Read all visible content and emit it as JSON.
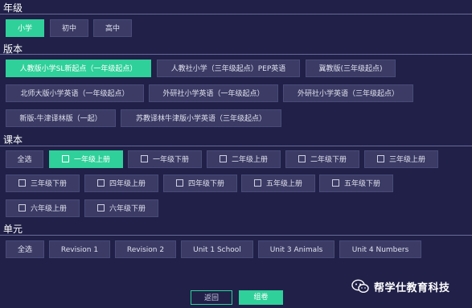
{
  "grade": {
    "title": "年级",
    "options": [
      "小学",
      "初中",
      "高中"
    ],
    "selected": "小学"
  },
  "edition": {
    "title": "版本",
    "options": [
      "人教版小学SL新起点（一年级起点）",
      "人教社小学（三年级起点）PEP英语",
      "冀教版(三年级起点)",
      "北师大版小学英语（一年级起点）",
      "外研社小学英语（一年级起点）",
      "外研社小学英语（三年级起点）",
      "新版-牛津译林版（一起）",
      "苏教译林牛津版小学英语（三年级起点）"
    ],
    "selected": "人教版小学SL新起点（一年级起点）"
  },
  "textbook": {
    "title": "课本",
    "select_all": "全选",
    "options": [
      "一年级上册",
      "一年级下册",
      "二年级上册",
      "二年级下册",
      "三年级上册",
      "三年级下册",
      "四年级上册",
      "四年级下册",
      "五年级上册",
      "五年级下册",
      "六年级上册",
      "六年级下册"
    ],
    "checked": [
      "一年级上册"
    ]
  },
  "unit": {
    "title": "单元",
    "select_all": "全选",
    "options": [
      "Revision 1",
      "Revision 2",
      "Unit 1 School",
      "Unit 3 Animals",
      "Unit 4 Numbers"
    ]
  },
  "footer": {
    "back_label": "返回",
    "make_label": "组卷"
  },
  "watermark": {
    "text": "帮学仕教育科技",
    "icon": "wechat-icon"
  },
  "colors": {
    "background": "#202048",
    "accent": "#2fd09a",
    "button": "#3b3b66",
    "divider": "#6a6a9a"
  }
}
